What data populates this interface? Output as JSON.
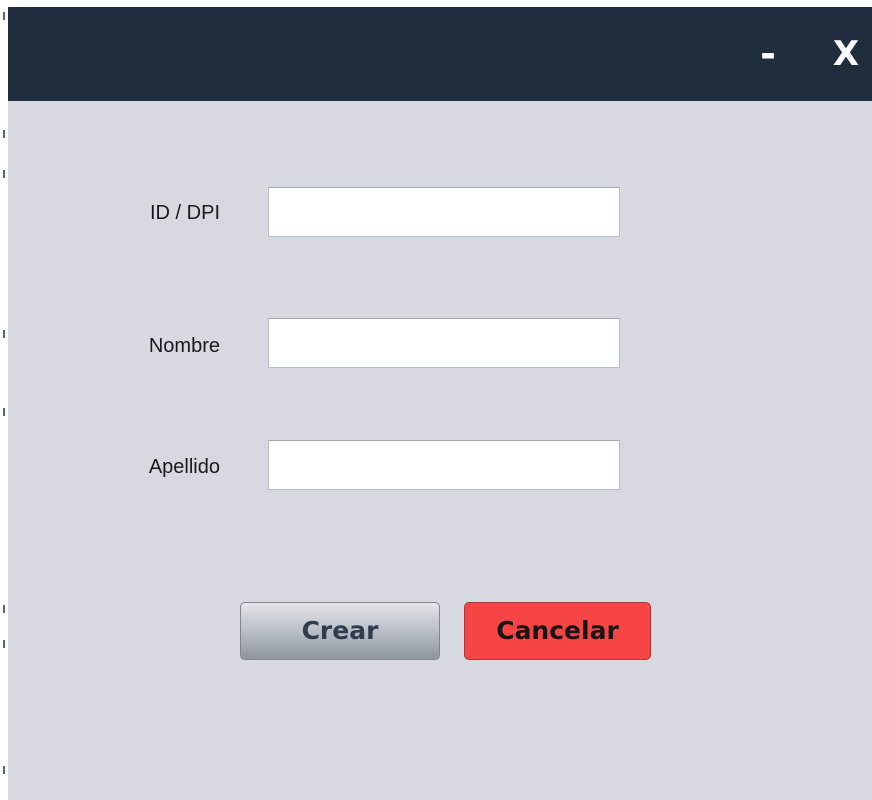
{
  "window": {
    "titlebar": {
      "minimize_label": "-",
      "close_label": "X",
      "background": "#202d3c"
    }
  },
  "form": {
    "fields": [
      {
        "label": "ID / DPI",
        "value": "",
        "placeholder": ""
      },
      {
        "label": "Nombre",
        "value": "",
        "placeholder": ""
      },
      {
        "label": "Apellido",
        "value": "",
        "placeholder": ""
      }
    ]
  },
  "actions": {
    "create_label": "Crear",
    "cancel_label": "Cancelar",
    "cancel_color": "#f74444"
  }
}
